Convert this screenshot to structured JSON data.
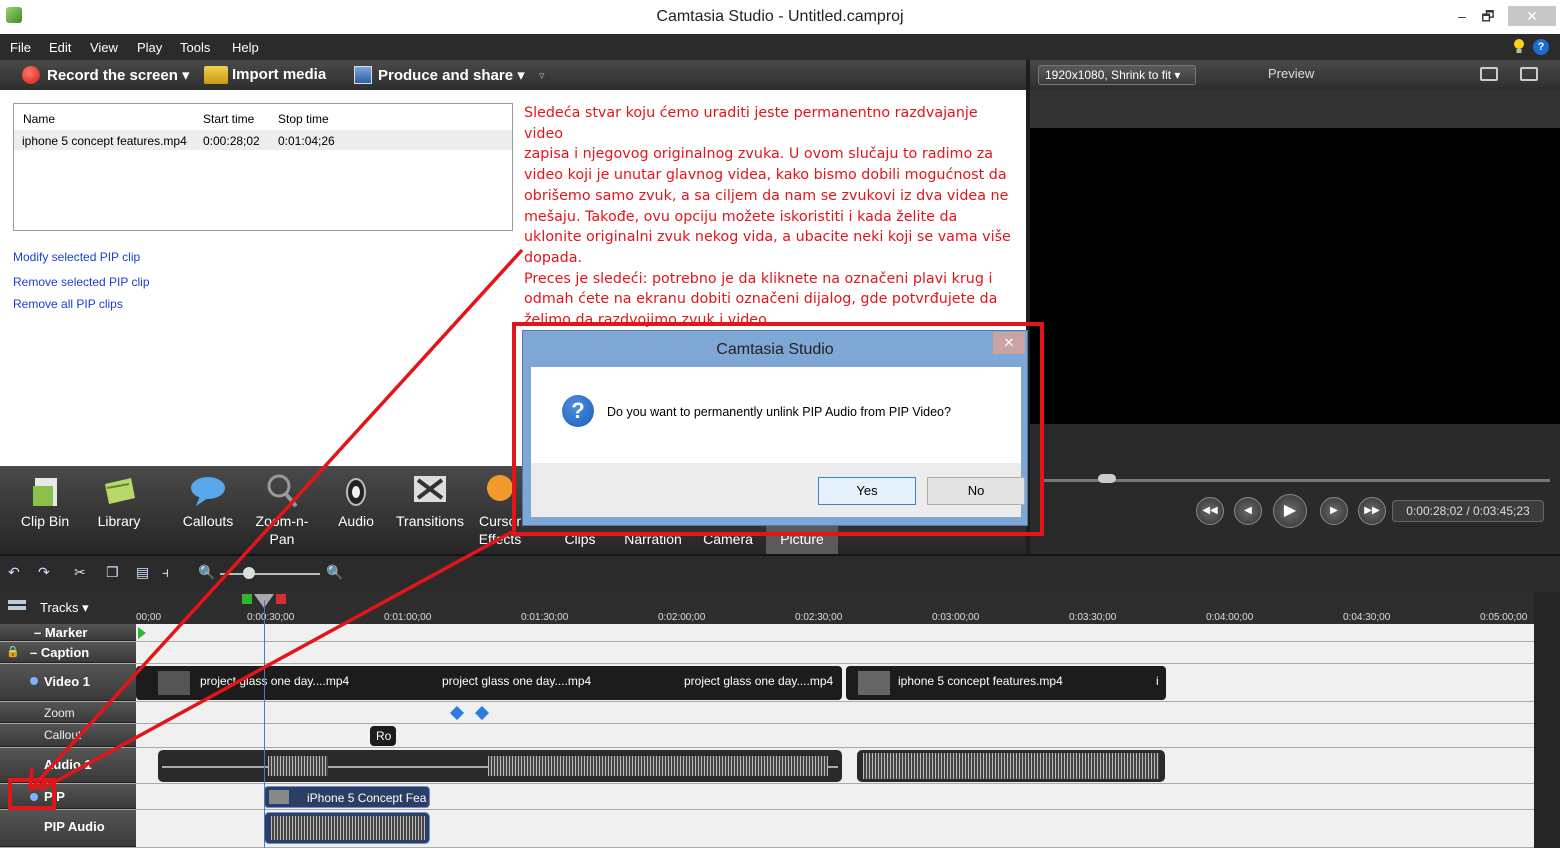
{
  "window": {
    "title": "Camtasia Studio - Untitled.camproj",
    "minimize": "–",
    "maximize": "🗗",
    "close": "✕"
  },
  "menu": [
    "File",
    "Edit",
    "View",
    "Play",
    "Tools",
    "Help"
  ],
  "toolbar": {
    "record": "Record the screen ▾",
    "import": "Import media",
    "produce": "Produce and share ▾",
    "overflow": "▿"
  },
  "pip_list": {
    "headers": {
      "name": "Name",
      "start": "Start time",
      "stop": "Stop time"
    },
    "rows": [
      {
        "name": "iphone 5 concept features.mp4",
        "start": "0:00:28;02",
        "stop": "0:01:04;26"
      }
    ]
  },
  "links": [
    "Modify selected PIP clip",
    "Remove selected PIP clip",
    "Remove all PIP clips"
  ],
  "annotation_text": [
    "Sledeća stvar koju ćemo uraditi jeste permanentno razdvajanje video",
    "zapisa i njegovog originalnog zvuka. U ovom slučaju to radimo za",
    "video koji je unutar glavnog videa, kako bismo dobili mogućnost da",
    "obrišemo samo zvuk, a sa ciljem da nam se zvukovi iz dva videa ne",
    "mešaju. Takođe, ovu opciju možete iskoristiti i kada želite da",
    "uklonite originalni zvuk nekog vida, a ubacite neki koji se vama više",
    "dopada.",
    "Preces je sledeći: potrebno je da kliknete na označeni plavi krug i",
    "odmah ćete na ekranu dobiti označeni dijalog, gde potvrđujete da",
    "želimo da razdvojimo zvuk i video."
  ],
  "preview": {
    "dimensions": "1920x1080, Shrink to fit ▾",
    "label": "Preview",
    "time": "0:00:28;02 / 0:03:45;23"
  },
  "tabs": [
    {
      "label": "Clip Bin",
      "icon": "clip-bin-icon"
    },
    {
      "label": "Library",
      "icon": "library-icon"
    },
    {
      "label": "Callouts",
      "icon": "callouts-icon"
    },
    {
      "label": "Zoom-n-\nPan",
      "icon": "zoom-n-pan-icon"
    },
    {
      "label": "Audio",
      "icon": "audio-icon"
    },
    {
      "label": "Transitions",
      "icon": "transitions-icon"
    },
    {
      "label": "Cursor\nEffects",
      "icon": "cursor-effects-icon"
    },
    {
      "label": "Clips",
      "icon": ""
    },
    {
      "label": "Narration",
      "icon": ""
    },
    {
      "label": "Camera",
      "icon": ""
    },
    {
      "label": "Picture",
      "icon": ""
    }
  ],
  "timeline": {
    "tracks_label": "Tracks ▾",
    "ticks": [
      "00;00",
      "0:00:30;00",
      "0:01:00;00",
      "0:01:30;00",
      "0:02:00;00",
      "0:02:30;00",
      "0:03:00;00",
      "0:03:30;00",
      "0:04:00;00",
      "0:04:30;00",
      "0:05:00;00"
    ],
    "track_names": {
      "marker": "– Marker",
      "caption": "– Caption",
      "video1": "Video 1",
      "zoom": "Zoom",
      "callout": "Callout",
      "audio1": "Audio 1",
      "pip": "PIP",
      "pip_audio": "PIP Audio"
    },
    "clips": {
      "v1a": "project glass one day....mp4",
      "v1b": "project glass one day....mp4",
      "v1c": "project glass one day....mp4",
      "v1d": "iphone 5 concept features.mp4",
      "v1d_end": "i",
      "callout": "Ro",
      "pip": "iPhone 5 Concept Fea"
    }
  },
  "dialog": {
    "title": "Camtasia Studio",
    "close": "✕",
    "icon": "?",
    "message": "Do you want to permanently unlink PIP Audio from PIP Video?",
    "yes": "Yes",
    "no": "No"
  }
}
